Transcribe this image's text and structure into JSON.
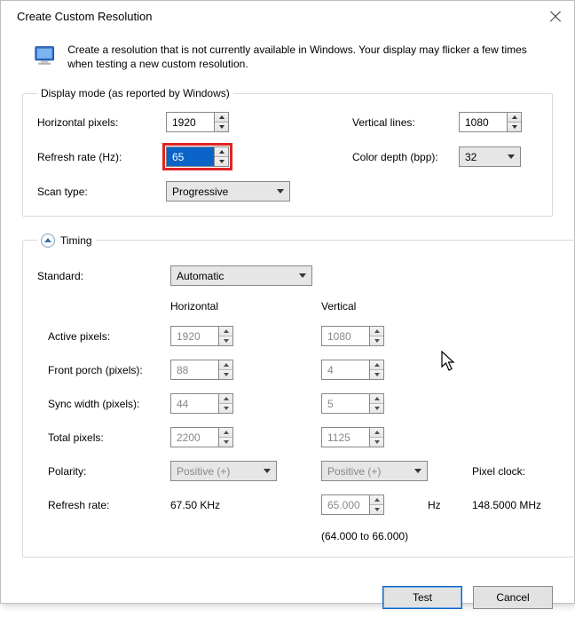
{
  "window": {
    "title": "Create Custom Resolution"
  },
  "intro": "Create a resolution that is not currently available in Windows. Your display may flicker a few times when testing a new custom resolution.",
  "display_mode": {
    "legend": "Display mode (as reported by Windows)",
    "horizontal_pixels_label": "Horizontal pixels:",
    "horizontal_pixels": "1920",
    "vertical_lines_label": "Vertical lines:",
    "vertical_lines": "1080",
    "refresh_rate_label": "Refresh rate (Hz):",
    "refresh_rate": "65",
    "color_depth_label": "Color depth (bpp):",
    "color_depth": "32",
    "scan_type_label": "Scan type:",
    "scan_type": "Progressive"
  },
  "timing": {
    "legend": "Timing",
    "standard_label": "Standard:",
    "standard": "Automatic",
    "col_horizontal": "Horizontal",
    "col_vertical": "Vertical",
    "rows": {
      "active_pixels": {
        "label": "Active pixels:",
        "h": "1920",
        "v": "1080"
      },
      "front_porch": {
        "label": "Front porch (pixels):",
        "h": "88",
        "v": "4"
      },
      "sync_width": {
        "label": "Sync width (pixels):",
        "h": "44",
        "v": "5"
      },
      "total_pixels": {
        "label": "Total pixels:",
        "h": "2200",
        "v": "1125"
      }
    },
    "polarity_label": "Polarity:",
    "polarity_h": "Positive (+)",
    "polarity_v": "Positive (+)",
    "refresh_rate_label": "Refresh rate:",
    "refresh_rate_h": "67.50 KHz",
    "refresh_rate_v": "65.000",
    "refresh_rate_v_unit": "Hz",
    "refresh_range": "(64.000 to 66.000)",
    "pixel_clock_label": "Pixel clock:",
    "pixel_clock": "148.5000 MHz"
  },
  "buttons": {
    "test": "Test",
    "cancel": "Cancel"
  }
}
